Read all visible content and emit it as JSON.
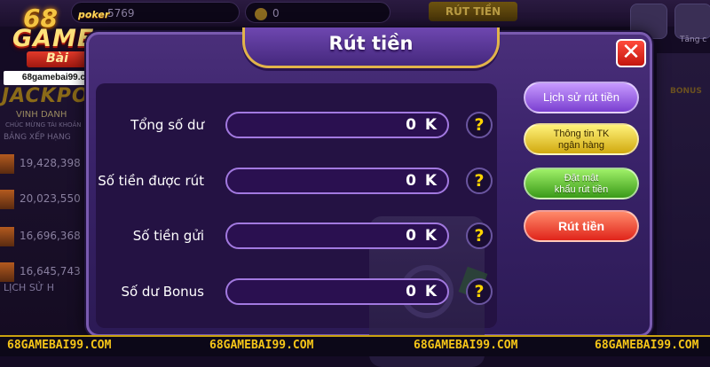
{
  "background": {
    "balance_pill": "5769",
    "coin_pill": "0",
    "tab_label": "RÚT TIỀN",
    "side_label": "Tăng c",
    "bonus_label": "BONUS",
    "jackpot": "JACKPOT",
    "vinh_danh": "VINH DANH",
    "chuc_mung": "CHÚC MỪNG TÀI KHOẢN",
    "bang_xep_hang": "BẢNG XẾP HẠNG",
    "leaderboard": [
      "19,428,398",
      "20,023,550",
      "16,696,368",
      "16,645,743"
    ],
    "lich_su": "LỊCH SỬ H"
  },
  "logo": {
    "number": "68",
    "poker": "poker",
    "game": "GAME",
    "bai": "Bài",
    "url": "68gamebai99.com"
  },
  "dialog": {
    "title": "Rút tiền",
    "close_symbol": "✕",
    "rows": [
      {
        "label": "Tổng số dư",
        "value": "0 K"
      },
      {
        "label": "Số tiền được rút",
        "value": "0 K"
      },
      {
        "label": "Số tiền gửi",
        "value": "0 K"
      },
      {
        "label": "Số dư Bonus",
        "value": "0 K"
      }
    ],
    "help_symbol": "?",
    "buttons": {
      "history": "Lịch sử rút tiền",
      "bank_line1": "Thông tin TK",
      "bank_line2": "ngân hàng",
      "pass_line1": "Đặt mật",
      "pass_line2": "khẩu rút tiền",
      "withdraw": "Rút tiền"
    }
  },
  "watermark": [
    "68GAMEBAI99.COM",
    "68GAMEBAI99.COM",
    "68GAMEBAI99.COM",
    "68GAMEBAI99.COM"
  ],
  "colors": {
    "dialog_bg": "#3a236a",
    "gold_border": "#e2b44a",
    "close_red": "#c4150e",
    "history_purple": "#7a3fd0",
    "bank_yellow": "#d1a90f",
    "pass_green": "#3a9a18",
    "withdraw_red": "#e0241a",
    "help_yellow": "#ffd400"
  }
}
